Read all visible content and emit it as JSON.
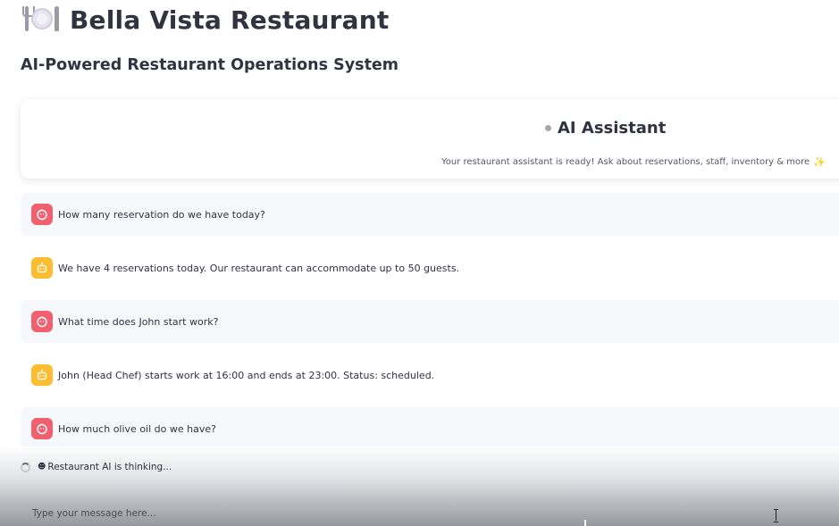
{
  "header": {
    "title": "Bella Vista Restaurant",
    "title_icon": "plate-with-cutlery-icon",
    "subtitle": "AI-Powered Restaurant Operations System"
  },
  "assistant_card": {
    "heading": "AI Assistant",
    "description": "Your restaurant assistant is ready! Ask about reservations, staff, inventory & more",
    "sparkle_icon": "sparkles-icon"
  },
  "messages": [
    {
      "role": "user",
      "text": "How many reservation do we have today?"
    },
    {
      "role": "assistant",
      "text": "We have 4 reservations today. Our restaurant can accommodate up to 50 guests."
    },
    {
      "role": "user",
      "text": "What time does John start work?"
    },
    {
      "role": "assistant",
      "text": "John (Head Chef) starts work at 16:00 and ends at 23:00. Status: scheduled."
    },
    {
      "role": "user",
      "text": "How much olive oil do we have?"
    }
  ],
  "status": {
    "thinking_text": "Restaurant AI is thinking..."
  },
  "chat_input": {
    "placeholder": "Type your message here...",
    "value": ""
  },
  "colors": {
    "user_avatar": "#f0616f",
    "assistant_avatar": "#fdbd30",
    "user_message_bg": "#f7f8fb",
    "text": "#31333f"
  }
}
